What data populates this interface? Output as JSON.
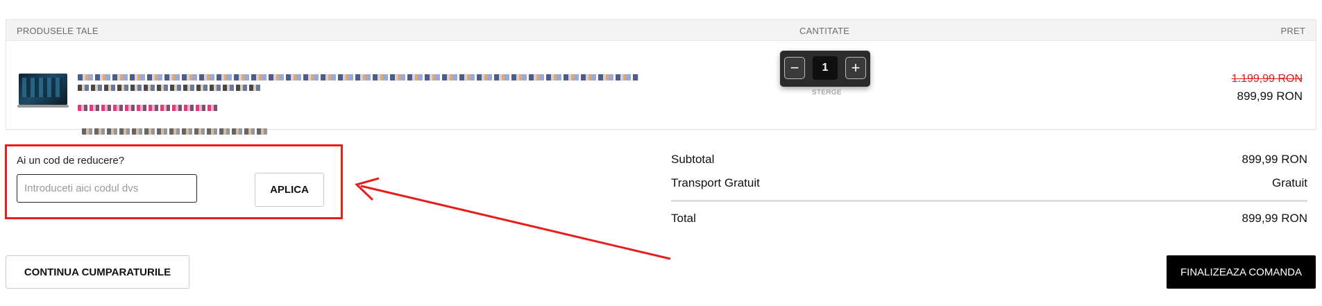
{
  "cart": {
    "headers": {
      "products": "PRODUSELE TALE",
      "quantity": "CANTITATE",
      "price": "PRET"
    },
    "item": {
      "quantity": "1",
      "minus_icon": "minus-icon",
      "plus_icon": "plus-icon",
      "remove_label": "STERGE",
      "old_price": "1.199,99 RON",
      "new_price": "899,99 RON"
    }
  },
  "coupon": {
    "label": "Ai un cod de reducere?",
    "placeholder": "Introduceti aici codul dvs",
    "apply_label": "APLICA"
  },
  "totals": {
    "subtotal_label": "Subtotal",
    "subtotal_value": "899,99 RON",
    "shipping_label": "Transport Gratuit",
    "shipping_value": "Gratuit",
    "total_label": "Total",
    "total_value": "899,99 RON"
  },
  "actions": {
    "continue_label": "CONTINUA CUMPARATURILE",
    "checkout_label": "FINALIZEAZA COMANDA"
  },
  "colors": {
    "highlight": "#e61e1e",
    "old_price": "#e01b1b",
    "checkout_bg": "#000000",
    "header_bg": "#f3f3f3"
  }
}
